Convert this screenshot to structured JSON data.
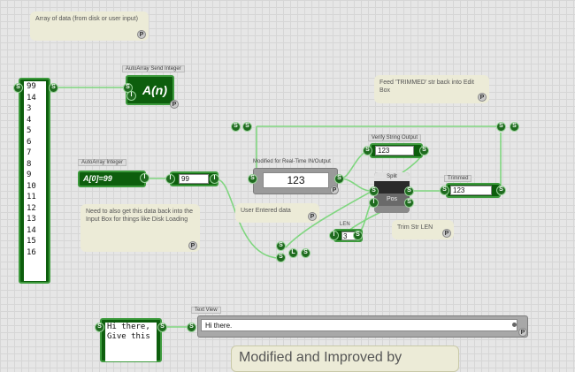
{
  "notes": {
    "array_note": "Array of data (from disk or user input)",
    "feed_note": "Feed 'TRIMMED' str back into Edit Box",
    "need_note": "Need to also get this data back into the Input Box for things like Disk Loading",
    "user_entered": "User Entered data",
    "trim_note": "Trim Str LEN",
    "big_note": "Modified and Improved by"
  },
  "array_values": [
    "99",
    "14",
    "3",
    "4",
    "5",
    "6",
    "7",
    "8",
    "9",
    "10",
    "11",
    "12",
    "13",
    "14",
    "15",
    "16"
  ],
  "modules": {
    "send_integer": {
      "label": "AutoArray Send Integer",
      "text": "A(n)"
    },
    "auto_integer": {
      "label": "AutoArray Integer",
      "text": "A[0]=99"
    },
    "int_box": {
      "value": "99"
    },
    "realtime": {
      "label": "Modified for Real-Time IN/Output",
      "value": "123"
    },
    "verify": {
      "label": "Verify String Output",
      "value": "123"
    },
    "split": {
      "label": "Split",
      "pos": "Pos"
    },
    "trimmed": {
      "label": "Trimmed",
      "value": "123"
    },
    "len": {
      "label": "LEN",
      "value": "3"
    },
    "text_view": {
      "label": "Text View",
      "value": "Hi there."
    },
    "text_list": {
      "line1": "Hi there,",
      "line2": "Give this"
    }
  },
  "glyphs": {
    "s": "S",
    "i": "I",
    "l": "L",
    "p": "P"
  },
  "colors": {
    "module_green": "#0d5e0d",
    "wire_green": "#7fd67f",
    "background": "#e6e6e6"
  }
}
